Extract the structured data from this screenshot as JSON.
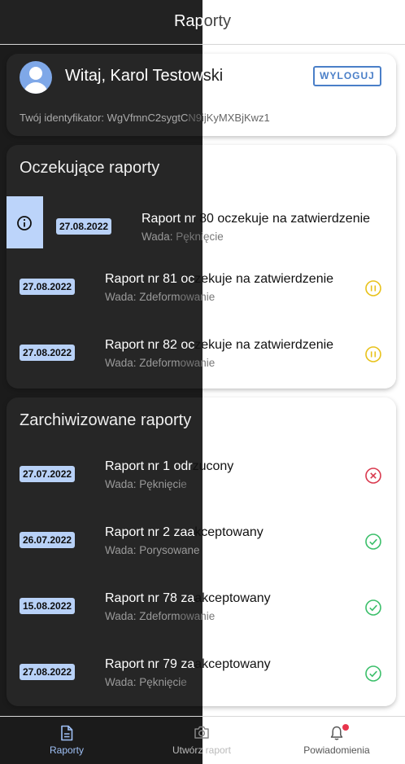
{
  "appbar": {
    "title_left": "Rap",
    "title_right": "orty"
  },
  "user": {
    "greeting_left": "Witaj, Karol Testow",
    "greeting_right": "ski",
    "logout_label": "WYLOGUJ",
    "id_left": "Twój identyfikator: WgVfmnC2sygtC",
    "id_right": "N9ijKyMXBjKwz1"
  },
  "pending": {
    "title": "Oczekujące raporty",
    "items": [
      {
        "date": "27.08.2022",
        "title_left": "Raport nr ",
        "title_right": "80 oczekuje na zatwierdzenie",
        "sub_left": "Wada: ",
        "sub_right": "Pęknięcie",
        "status": "info-icon"
      },
      {
        "date": "27.08.2022",
        "title_left": "Raport nr 81 oc",
        "title_right": "zekuje na zatwierdzenie",
        "sub_left": "Wada: Zdeform",
        "sub_right": "owanie",
        "status": "pause-icon"
      },
      {
        "date": "27.08.2022",
        "title_left": "Raport nr 82 oc",
        "title_right": "zekuje na zatwierdzenie",
        "sub_left": "Wada: Zdeform",
        "sub_right": "owanie",
        "status": "pause-icon"
      }
    ]
  },
  "archived": {
    "title": "Zarchiwizowane raporty",
    "items": [
      {
        "date": "27.07.2022",
        "title_left": "Raport nr 1 odr",
        "title_right": "zucony",
        "sub_left": "Wada: Pęknięci",
        "sub_right": "e",
        "status": "rejected-icon"
      },
      {
        "date": "26.07.2022",
        "title_left": "Raport nr 2 zaa",
        "title_right": "kceptowany",
        "sub_left": "Wada: Porysowane",
        "sub_right": "",
        "status": "accepted-icon"
      },
      {
        "date": "15.08.2022",
        "title_left": "Raport nr 78 za",
        "title_right": "akceptowany",
        "sub_left": "Wada: Zdeform",
        "sub_right": "owanie",
        "status": "accepted-icon"
      },
      {
        "date": "27.08.2022",
        "title_left": "Raport nr 79 za",
        "title_right": "akceptowany",
        "sub_left": "Wada: Pęknięci",
        "sub_right": "e",
        "status": "accepted-icon"
      }
    ]
  },
  "nav": {
    "reports_label": "Raporty",
    "create_label": "Utwórz raport",
    "notifications_label": "Powiadomienia"
  },
  "colors": {
    "accent": "#4a7fc8",
    "date_badge": "#b8d1f7",
    "pause": "#e8c21a",
    "accepted": "#3bbf6a",
    "rejected": "#d9394e"
  }
}
